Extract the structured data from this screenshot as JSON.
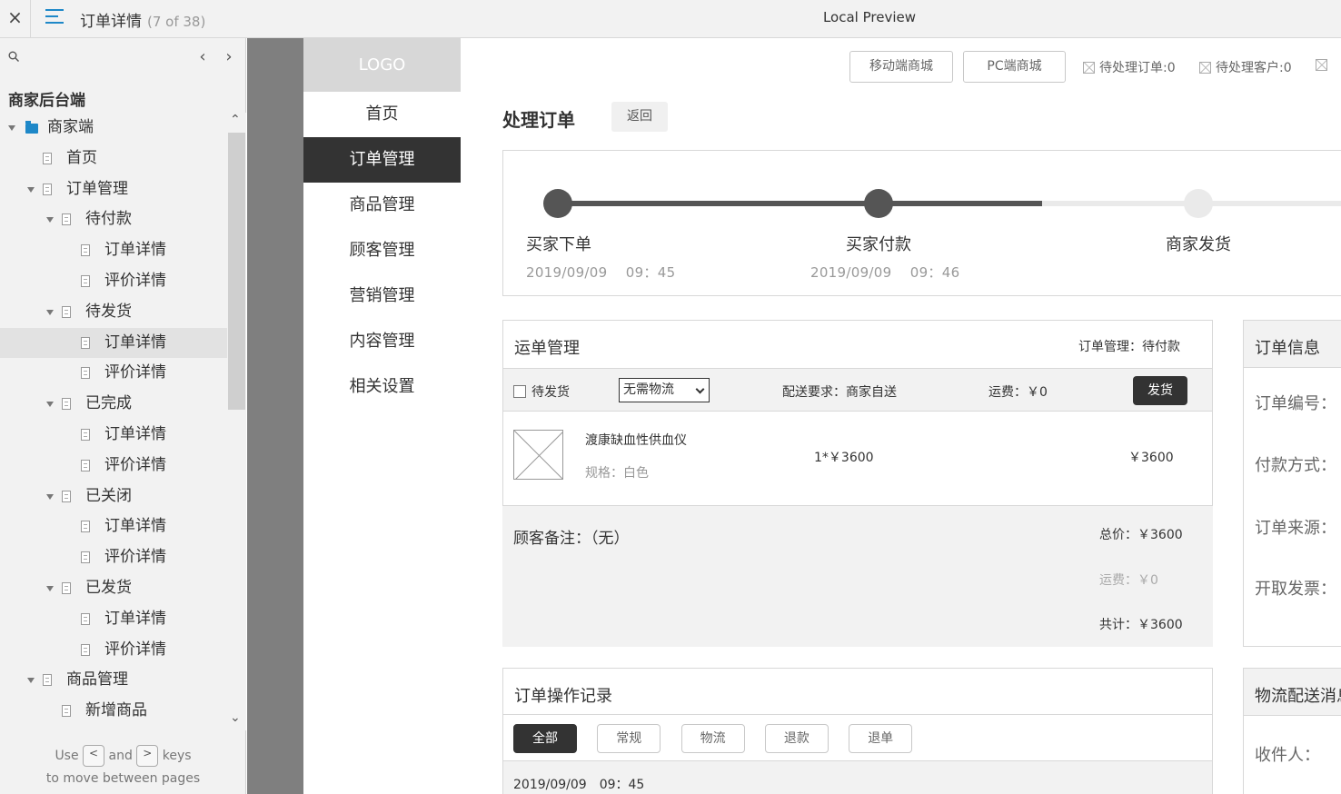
{
  "topbar": {
    "close_glyph": "×",
    "page_title": "订单详情",
    "page_count": "(7 of 38)",
    "preview_title": "Local Preview"
  },
  "sidebar": {
    "project_title": "商家后台端",
    "tree": [
      {
        "label": "商家端",
        "type": "folder",
        "level": 0,
        "expanded": true
      },
      {
        "label": "首页",
        "type": "page",
        "level": 1
      },
      {
        "label": "订单管理",
        "type": "page",
        "level": 1,
        "expanded": true
      },
      {
        "label": "待付款",
        "type": "page",
        "level": 2,
        "expanded": true
      },
      {
        "label": "订单详情",
        "type": "page",
        "level": 3
      },
      {
        "label": "评价详情",
        "type": "page",
        "level": 3
      },
      {
        "label": "待发货",
        "type": "page",
        "level": 2,
        "expanded": true
      },
      {
        "label": "订单详情",
        "type": "page",
        "level": 3,
        "active": true
      },
      {
        "label": "评价详情",
        "type": "page",
        "level": 3
      },
      {
        "label": "已完成",
        "type": "page",
        "level": 2,
        "expanded": true
      },
      {
        "label": "订单详情",
        "type": "page",
        "level": 3
      },
      {
        "label": "评价详情",
        "type": "page",
        "level": 3
      },
      {
        "label": "已关闭",
        "type": "page",
        "level": 2,
        "expanded": true
      },
      {
        "label": "订单详情",
        "type": "page",
        "level": 3
      },
      {
        "label": "评价详情",
        "type": "page",
        "level": 3
      },
      {
        "label": "已发货",
        "type": "page",
        "level": 2,
        "expanded": true
      },
      {
        "label": "订单详情",
        "type": "page",
        "level": 3
      },
      {
        "label": "评价详情",
        "type": "page",
        "level": 3
      },
      {
        "label": "商品管理",
        "type": "page",
        "level": 1,
        "expanded": true
      },
      {
        "label": "新增商品",
        "type": "page",
        "level": 2
      }
    ],
    "hint": {
      "use": "Use",
      "key_prev": "<",
      "and": "and",
      "key_next": ">",
      "keys": "keys",
      "line2": "to move between pages"
    }
  },
  "leftnav": {
    "logo": "LOGO",
    "items": [
      "首页",
      "订单管理",
      "商品管理",
      "顾客管理",
      "营销管理",
      "内容管理",
      "相关设置"
    ],
    "active_index": 1
  },
  "header": {
    "mobile_mall": "移动端商城",
    "pc_mall": "PC端商城",
    "pending_orders": "待处理订单:0",
    "pending_customers": "待处理客户:0"
  },
  "order": {
    "title": "处理订单",
    "back": "返回",
    "progress": {
      "steps": [
        {
          "label": "买家下单",
          "date": "2019/09/09",
          "time": "09：45",
          "done": true
        },
        {
          "label": "买家付款",
          "date": "2019/09/09",
          "time": "09：46",
          "done": true
        },
        {
          "label": "商家发货",
          "date": "",
          "time": "",
          "done": false
        }
      ]
    },
    "shipping": {
      "title": "运单管理",
      "status": "订单管理：待付款",
      "checkbox_label": "待发货",
      "logistics_select": "无需物流",
      "delivery_req": "配送要求：商家自送",
      "freight": "运费：￥0",
      "ship_button": "发货",
      "product_name": "渡康缺血性供血仪",
      "spec": "规格：白色",
      "qty_price": "1*￥3600",
      "subtotal": "￥3600"
    },
    "summary": {
      "note": "顾客备注：（无）",
      "total": "总价：￥3600",
      "freight": "运费：￥0",
      "grand_total": "共计：￥3600"
    },
    "info": {
      "title": "订单信息",
      "order_no": "订单编号：",
      "payment": "付款方式：",
      "source": "订单来源：",
      "invoice": "开取发票："
    },
    "records": {
      "title": "订单操作记录",
      "tabs": [
        "全部",
        "常规",
        "物流",
        "退款",
        "退单"
      ],
      "active_tab": 0,
      "first_time": "2019/09/09　09：45"
    },
    "logistics": {
      "title": "物流配送消息",
      "receiver": "收件人："
    }
  },
  "colors": {
    "accent_blue": "#1e88c8",
    "dark": "#333333",
    "progress_done": "#555555",
    "progress_pending": "#e8e8e8"
  }
}
